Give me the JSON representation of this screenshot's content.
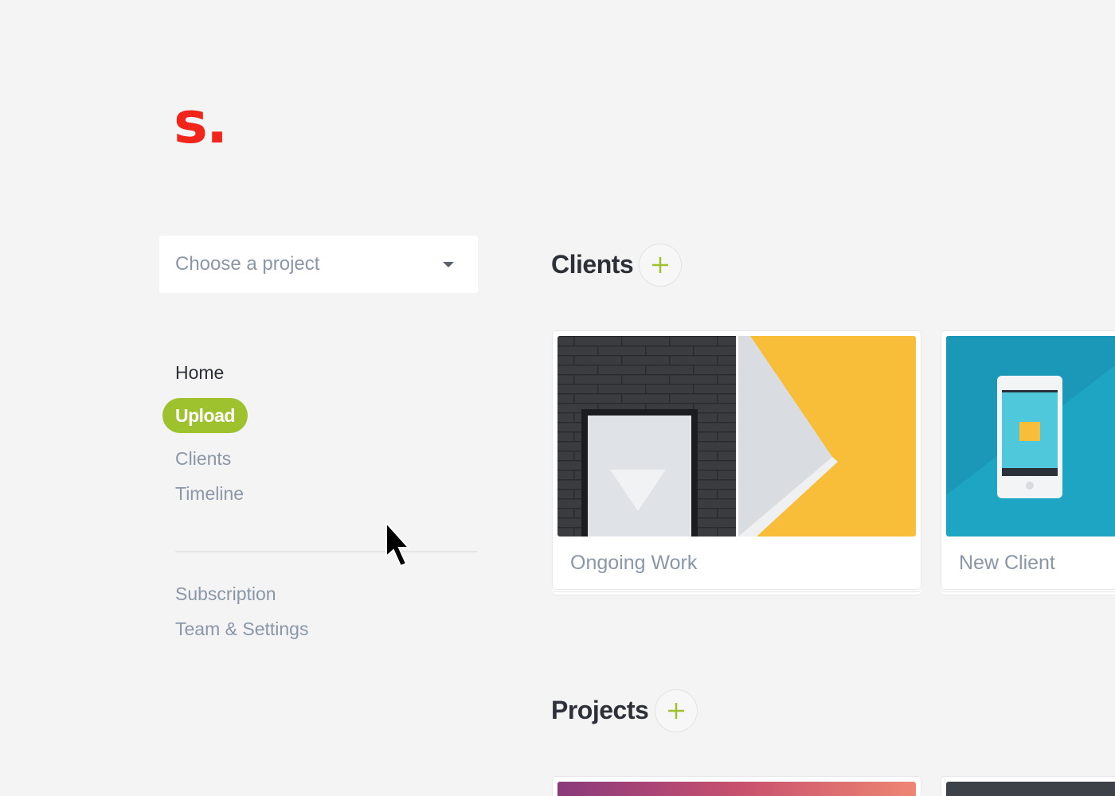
{
  "logo": {
    "text": "s."
  },
  "project_select": {
    "placeholder": "Choose a project"
  },
  "nav": {
    "primary": [
      {
        "label": "Home"
      },
      {
        "label": "Upload"
      },
      {
        "label": "Clients"
      },
      {
        "label": "Timeline"
      }
    ],
    "secondary": [
      {
        "label": "Subscription"
      },
      {
        "label": "Team & Settings"
      }
    ]
  },
  "clients": {
    "title": "Clients",
    "cards": [
      {
        "label": "Ongoing Work"
      },
      {
        "label": "New Client"
      }
    ]
  },
  "projects": {
    "title": "Projects"
  },
  "colors": {
    "brand": "#f1251a",
    "accent": "#9dc22d",
    "muted_text": "#8a97a8",
    "background": "#f4f4f4"
  },
  "icons": {
    "add": "plus-icon",
    "dropdown": "caret-down-icon",
    "cursor": "mouse-pointer-icon"
  }
}
